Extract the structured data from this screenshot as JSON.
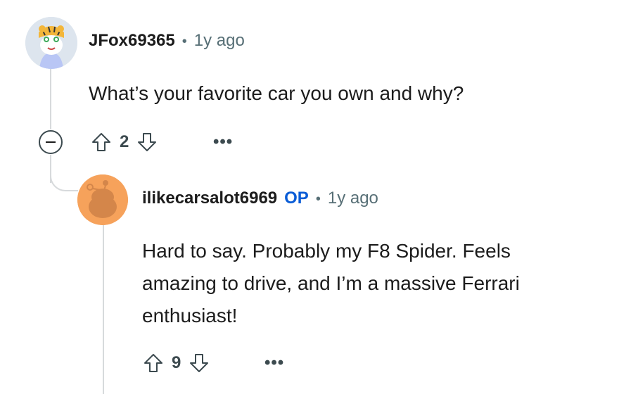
{
  "comment1": {
    "author": "JFox69365",
    "separator": "•",
    "time": "1y ago",
    "body": "What’s your favorite car you own and why?",
    "votes": "2",
    "more": "•••"
  },
  "comment2": {
    "author": "ilikecarsalot6969",
    "op_badge": "OP",
    "separator": "•",
    "time": "1y ago",
    "body": "Hard to say. Probably my F8 Spider. Feels amazing to drive, and I’m a massive Ferrari enthusiast!",
    "votes": "9",
    "more": "•••"
  },
  "colors": {
    "op": "#0a5cd6",
    "thread_line": "#d7dadc",
    "snoo_avatar_bg": "#f6a25b"
  }
}
